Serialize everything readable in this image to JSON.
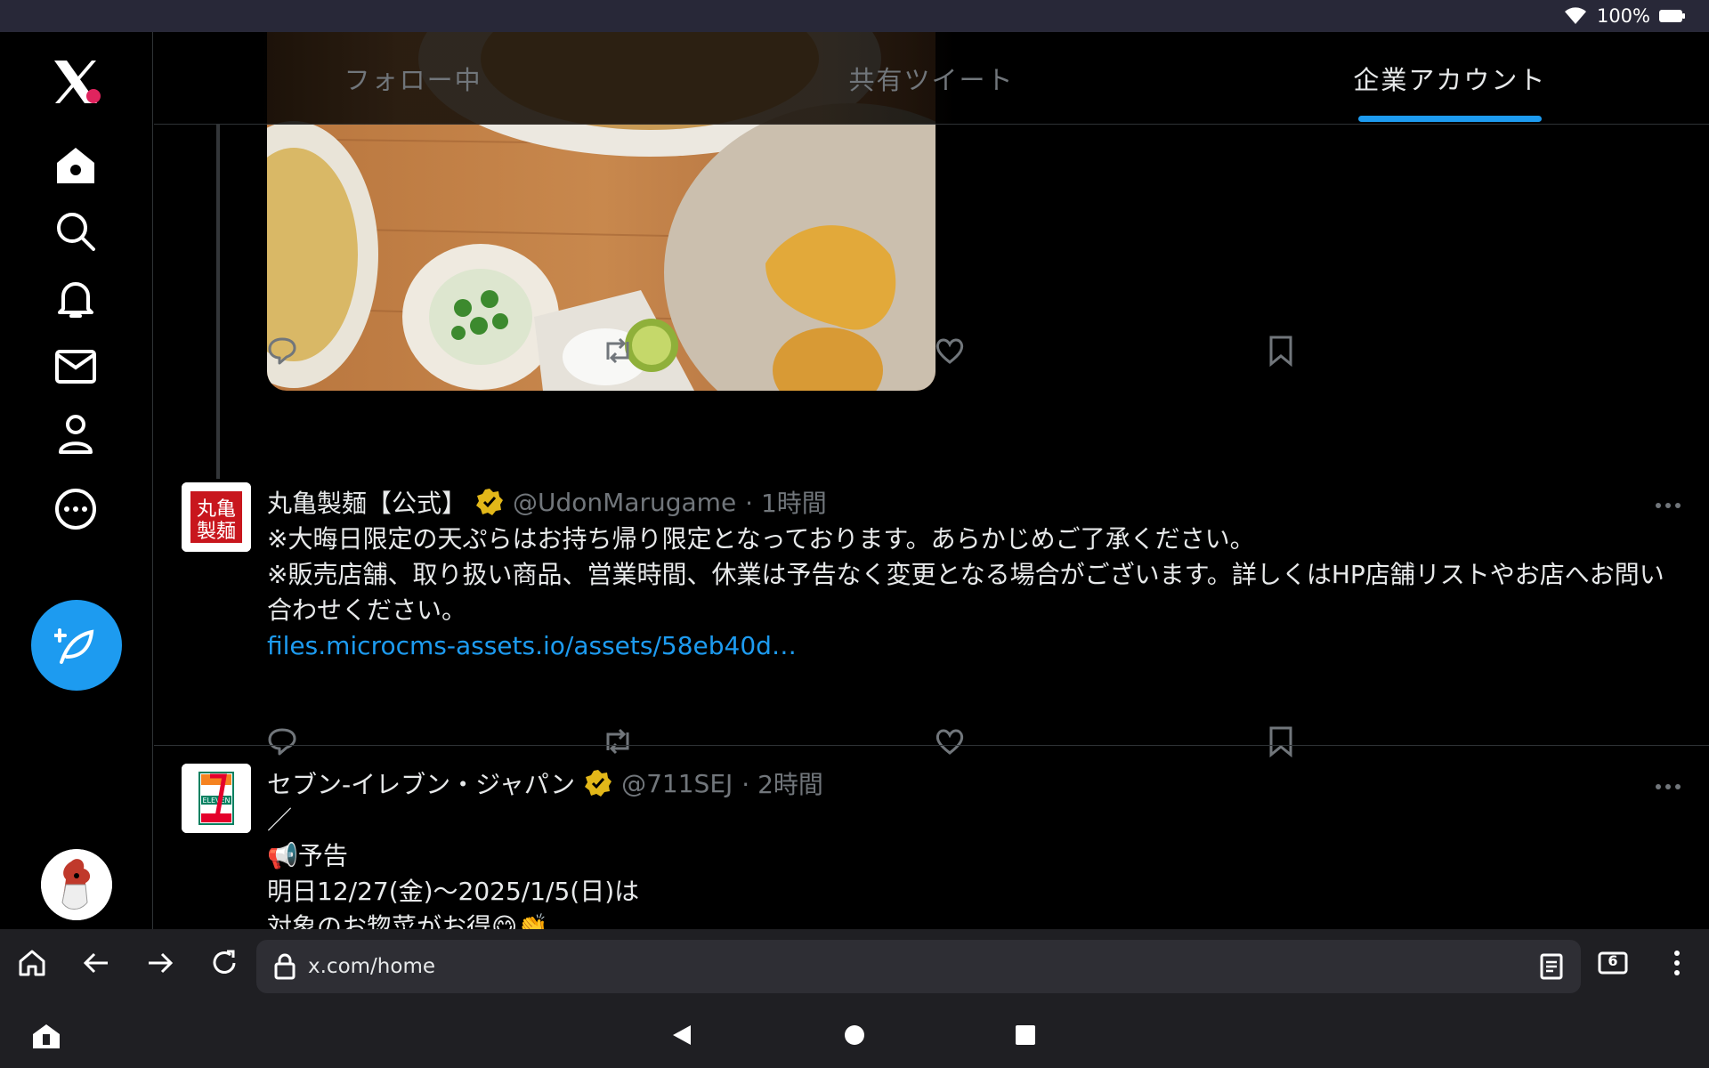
{
  "status": {
    "battery": "100%"
  },
  "tabs": [
    {
      "label": "フォロー中",
      "active": false
    },
    {
      "label": "共有ツイート",
      "active": false
    },
    {
      "label": "企業アカウント",
      "active": true
    }
  ],
  "tweets": [
    {
      "name": "丸亀製麺【公式】",
      "handle": "@UdonMarugame",
      "time": "· 1時間",
      "avatar_text": "丸亀製麺",
      "lines": [
        "※大晦日限定の天ぷらはお持ち帰り限定となっております。あらかじめご了承ください。",
        "※販売店舗、取り扱い商品、営業時間、休業は予告なく変更となる場合がございます。詳しくはHP店舗リストやお店へお問い合わせください。"
      ],
      "link": "files.microcms-assets.io/assets/58eb40d…"
    },
    {
      "name": "セブン-イレブン・ジャパン",
      "handle": "@711SEJ",
      "time": "· 2時間",
      "avatar_text": "ELEVEN",
      "lines": [
        "／",
        "📢予告",
        "明日12/27(金)〜2025/1/5(日)は",
        "対象のお惣菜がお得😋👏"
      ]
    }
  ],
  "browser": {
    "url": "x.com/home",
    "tab_count": "6"
  },
  "colors": {
    "accent": "#1d9bf0",
    "verified": "#e2b719",
    "bg": "#000000"
  }
}
